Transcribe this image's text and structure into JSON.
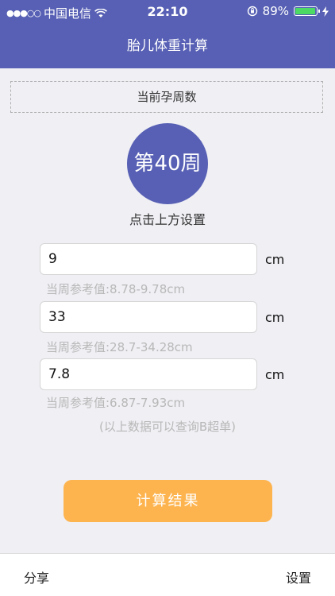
{
  "status_bar": {
    "signal": "●●●○○",
    "carrier": "中国电信",
    "wifi_icon": "wifi-icon",
    "time": "22:10",
    "lock_icon": "rotation-lock-icon",
    "battery_percent": "89%",
    "battery_level": 0.89,
    "charging_icon": "bolt-icon"
  },
  "nav": {
    "title": "胎儿体重计算"
  },
  "week_section": {
    "label": "当前孕周数",
    "week": "第40周",
    "hint": "点击上方设置"
  },
  "fields": [
    {
      "value": "9",
      "unit": "cm",
      "ref": "当周参考值:8.78-9.78cm"
    },
    {
      "value": "33",
      "unit": "cm",
      "ref": "当周参考值:28.7-34.28cm"
    },
    {
      "value": "7.8",
      "unit": "cm",
      "ref": "当周参考值:6.87-7.93cm"
    }
  ],
  "note": "(以上数据可以查询B超单)",
  "calc_button": "计算结果",
  "bottom_bar": {
    "share": "分享",
    "settings": "设置"
  },
  "colors": {
    "primary": "#5760b4",
    "button": "#fdb44f",
    "background": "#efeff4",
    "muted_text": "#b8b8b8"
  }
}
